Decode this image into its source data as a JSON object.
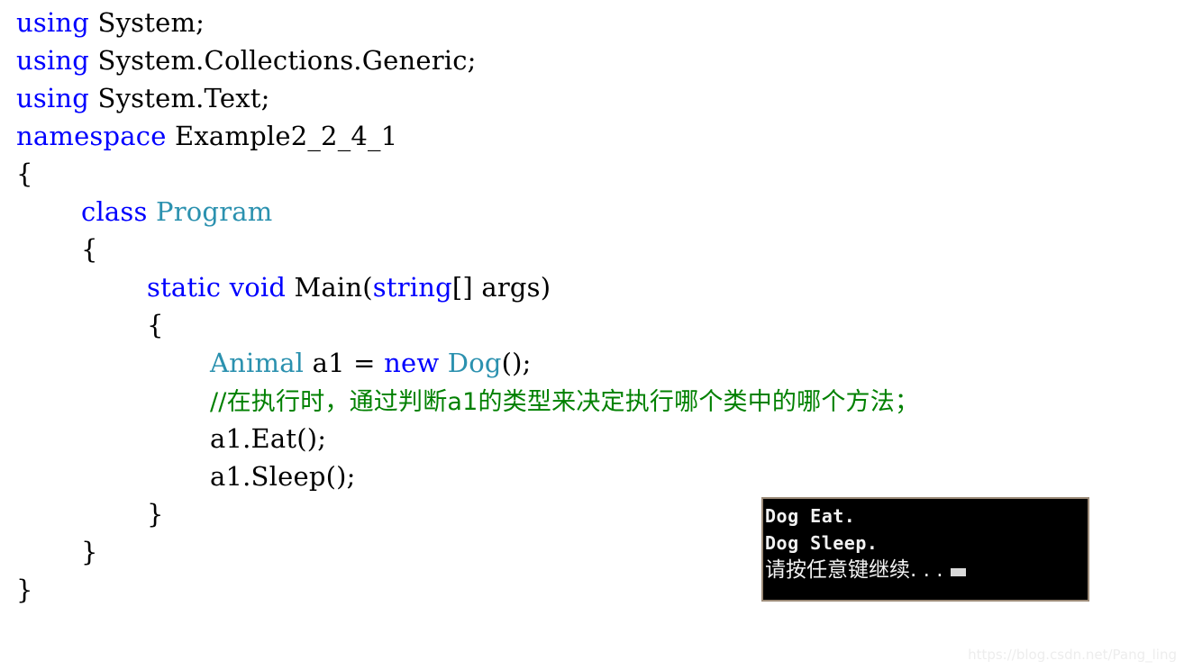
{
  "editor": {
    "language": "csharp",
    "background_color": "#ffffff",
    "colors": {
      "keyword": "#0000ff",
      "type": "#2b91af",
      "comment": "#008000",
      "plain": "#000000"
    },
    "lines": [
      {
        "indent": 0,
        "tokens": [
          {
            "t": "using",
            "c": "kw"
          },
          {
            "t": " System;",
            "c": "pl"
          }
        ]
      },
      {
        "indent": 0,
        "tokens": [
          {
            "t": "using",
            "c": "kw"
          },
          {
            "t": " System.Collections.Generic;",
            "c": "pl"
          }
        ]
      },
      {
        "indent": 0,
        "tokens": [
          {
            "t": "using",
            "c": "kw"
          },
          {
            "t": " System.Text;",
            "c": "pl"
          }
        ]
      },
      {
        "indent": 0,
        "tokens": [
          {
            "t": "namespace",
            "c": "kw"
          },
          {
            "t": " Example2_2_4_1",
            "c": "pl"
          }
        ]
      },
      {
        "indent": 0,
        "tokens": [
          {
            "t": "{",
            "c": "pl"
          }
        ]
      },
      {
        "indent": 1,
        "tokens": [
          {
            "t": "class",
            "c": "kw"
          },
          {
            "t": " ",
            "c": "pl"
          },
          {
            "t": "Program",
            "c": "typ"
          }
        ]
      },
      {
        "indent": 1,
        "tokens": [
          {
            "t": "{",
            "c": "pl"
          }
        ]
      },
      {
        "indent": 2,
        "tokens": [
          {
            "t": "static",
            "c": "kw"
          },
          {
            "t": " ",
            "c": "pl"
          },
          {
            "t": "void",
            "c": "kw"
          },
          {
            "t": " Main(",
            "c": "pl"
          },
          {
            "t": "string",
            "c": "kw"
          },
          {
            "t": "[] args)",
            "c": "pl"
          }
        ]
      },
      {
        "indent": 2,
        "tokens": [
          {
            "t": "{",
            "c": "pl"
          }
        ]
      },
      {
        "indent": 3,
        "tokens": [
          {
            "t": "Animal",
            "c": "typ"
          },
          {
            "t": " a1 = ",
            "c": "pl"
          },
          {
            "t": "new",
            "c": "kw"
          },
          {
            "t": " ",
            "c": "pl"
          },
          {
            "t": "Dog",
            "c": "typ"
          },
          {
            "t": "();",
            "c": "pl"
          }
        ]
      },
      {
        "indent": 3,
        "tokens": [
          {
            "t": "//在执行时，通过判断a1的类型来决定执行哪个类中的哪个方法；",
            "c": "cm"
          }
        ]
      },
      {
        "indent": 3,
        "tokens": [
          {
            "t": "a1.Eat();",
            "c": "pl"
          }
        ]
      },
      {
        "indent": 3,
        "tokens": [
          {
            "t": "a1.Sleep();",
            "c": "pl"
          }
        ]
      },
      {
        "indent": 2,
        "tokens": [
          {
            "t": "}",
            "c": "pl"
          }
        ]
      },
      {
        "indent": 1,
        "tokens": [
          {
            "t": "}",
            "c": "pl"
          }
        ]
      },
      {
        "indent": 0,
        "tokens": [
          {
            "t": "}",
            "c": "pl"
          }
        ]
      }
    ]
  },
  "console": {
    "title": "console-output",
    "background_color": "#000000",
    "text_color": "#f2f2f2",
    "border_color": "#9c8b78",
    "lines": [
      "Dog Eat.",
      "Dog Sleep.",
      "请按任意键继续. . ."
    ],
    "cursor": "block"
  },
  "watermark": {
    "text": "https://blog.csdn.net/Pang_ling",
    "color": "#ededed"
  }
}
